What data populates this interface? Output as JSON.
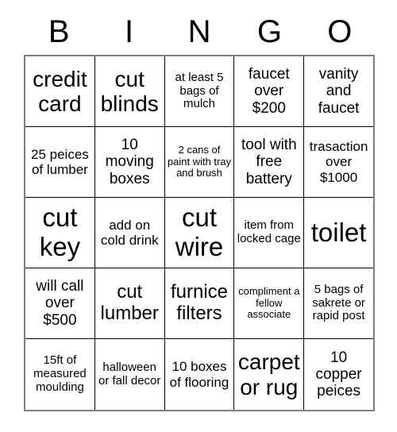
{
  "card": {
    "header_letters": [
      "B",
      "I",
      "N",
      "G",
      "O"
    ],
    "rows": [
      [
        {
          "text": "credit card",
          "size": "t-xl"
        },
        {
          "text": "cut blinds",
          "size": "t-xl"
        },
        {
          "text": "at least 5 bags of mulch",
          "size": "t-xs"
        },
        {
          "text": "faucet over $200",
          "size": "t-md"
        },
        {
          "text": "vanity and faucet",
          "size": "t-md"
        }
      ],
      [
        {
          "text": "25 peices of lumber",
          "size": "t-sm"
        },
        {
          "text": "10 moving boxes",
          "size": "t-md"
        },
        {
          "text": "2 cans of paint with tray and brush",
          "size": "t-xxs"
        },
        {
          "text": "tool with free battery",
          "size": "t-md"
        },
        {
          "text": "trasaction over $1000",
          "size": "t-sm"
        }
      ],
      [
        {
          "text": "cut key",
          "size": "t-xxl"
        },
        {
          "text": "add on cold drink",
          "size": "t-sm"
        },
        {
          "text": "cut wire",
          "size": "t-xxl"
        },
        {
          "text": "item from locked cage",
          "size": "t-xs"
        },
        {
          "text": "toilet",
          "size": "t-xxl"
        }
      ],
      [
        {
          "text": "will call over $500",
          "size": "t-md"
        },
        {
          "text": "cut lumber",
          "size": "t-lg"
        },
        {
          "text": "furnice filters",
          "size": "t-lg"
        },
        {
          "text": "compliment a fellow associate",
          "size": "t-xxs"
        },
        {
          "text": "5 bags of sakrete or rapid post",
          "size": "t-xs"
        }
      ],
      [
        {
          "text": "15ft of measured moulding",
          "size": "t-xs"
        },
        {
          "text": "halloween or fall decor",
          "size": "t-xs"
        },
        {
          "text": "10 boxes of flooring",
          "size": "t-sm"
        },
        {
          "text": "carpet or rug",
          "size": "t-xl"
        },
        {
          "text": "10 copper peices",
          "size": "t-md"
        }
      ]
    ]
  }
}
